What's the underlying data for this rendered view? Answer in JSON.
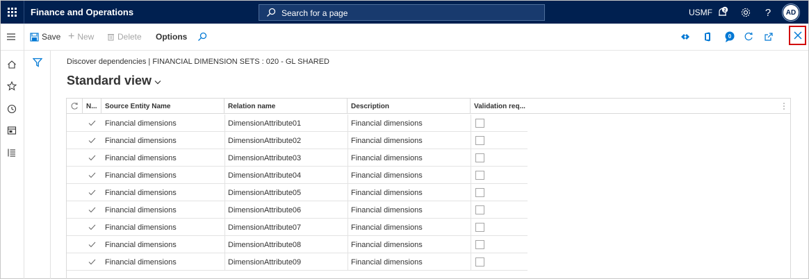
{
  "topbar": {
    "app_title": "Finance and Operations",
    "search_placeholder": "Search for a page",
    "company": "USMF",
    "notification_count": "2",
    "avatar_initials": "AD",
    "help_label": "?"
  },
  "actionbar": {
    "save": "Save",
    "new": "New",
    "delete": "Delete",
    "options": "Options",
    "badge_count": "0"
  },
  "content": {
    "breadcrumb": "Discover dependencies  |  FINANCIAL DIMENSION SETS : 020 - GL SHARED",
    "view_title": "Standard view"
  },
  "grid": {
    "columns": [
      "N...",
      "Source Entity Name",
      "Relation name",
      "Description",
      "Validation req..."
    ],
    "rows": [
      {
        "source": "Financial dimensions",
        "relation": "DimensionAttribute01",
        "description": "Financial dimensions"
      },
      {
        "source": "Financial dimensions",
        "relation": "DimensionAttribute02",
        "description": "Financial dimensions"
      },
      {
        "source": "Financial dimensions",
        "relation": "DimensionAttribute03",
        "description": "Financial dimensions"
      },
      {
        "source": "Financial dimensions",
        "relation": "DimensionAttribute04",
        "description": "Financial dimensions"
      },
      {
        "source": "Financial dimensions",
        "relation": "DimensionAttribute05",
        "description": "Financial dimensions"
      },
      {
        "source": "Financial dimensions",
        "relation": "DimensionAttribute06",
        "description": "Financial dimensions"
      },
      {
        "source": "Financial dimensions",
        "relation": "DimensionAttribute07",
        "description": "Financial dimensions"
      },
      {
        "source": "Financial dimensions",
        "relation": "DimensionAttribute08",
        "description": "Financial dimensions"
      },
      {
        "source": "Financial dimensions",
        "relation": "DimensionAttribute09",
        "description": "Financial dimensions"
      }
    ]
  },
  "colors": {
    "topbar_bg": "#002050",
    "accent_blue": "#0078d4",
    "close_highlight": "#d10000"
  }
}
